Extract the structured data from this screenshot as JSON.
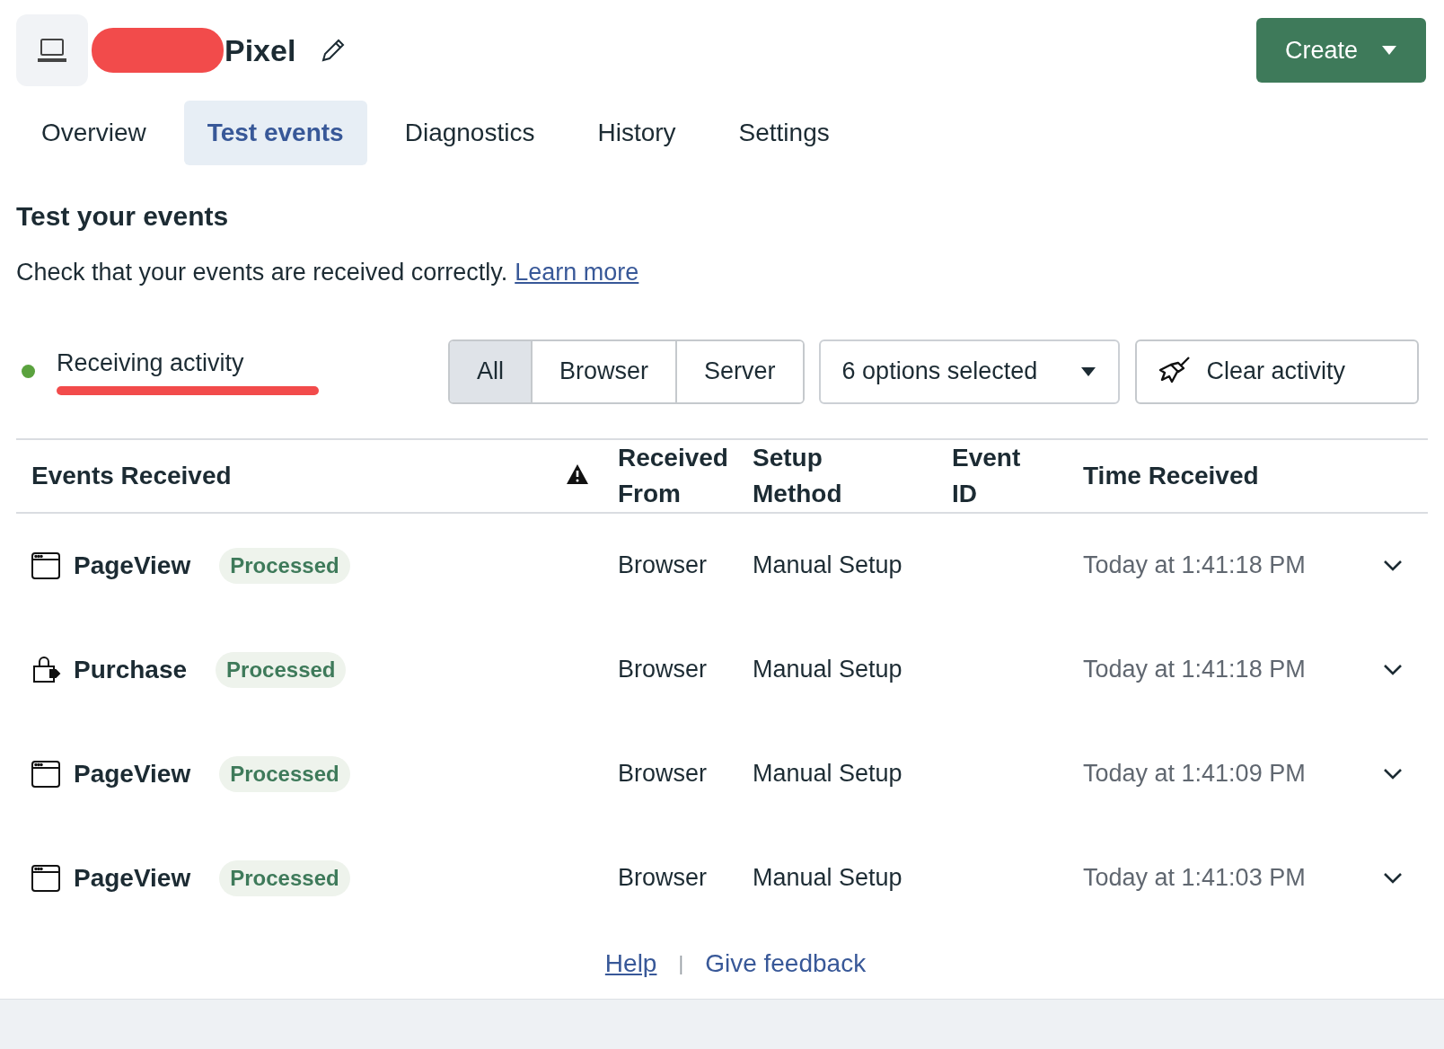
{
  "header": {
    "title": "Pixel",
    "create_button": "Create"
  },
  "tabs": [
    {
      "label": "Overview",
      "selected": false
    },
    {
      "label": "Test events",
      "selected": true
    },
    {
      "label": "Diagnostics",
      "selected": false
    },
    {
      "label": "History",
      "selected": false
    },
    {
      "label": "Settings",
      "selected": false
    }
  ],
  "section": {
    "title": "Test your events",
    "description": "Check that your events are received correctly.",
    "link": "Learn more"
  },
  "activity": {
    "status": "Receiving activity",
    "active": true
  },
  "source_filter": [
    {
      "label": "All",
      "selected": true
    },
    {
      "label": "Browser",
      "selected": false
    },
    {
      "label": "Server",
      "selected": false
    }
  ],
  "options_dropdown": "6 options selected",
  "clear_button": "Clear activity",
  "table": {
    "columns": [
      "Events Received",
      "Received From",
      "Setup Method",
      "Event ID",
      "Time Received"
    ],
    "rows": [
      {
        "kind": "pageview",
        "event": "PageView",
        "status": "Processed",
        "received_from": "Browser",
        "setup_method": "Manual Setup",
        "time": "Today at 1:41:18 PM"
      },
      {
        "kind": "purchase",
        "event": "Purchase",
        "status": "Processed",
        "received_from": "Browser",
        "setup_method": "Manual Setup",
        "time": "Today at 1:41:18 PM"
      },
      {
        "kind": "pageview",
        "event": "PageView",
        "status": "Processed",
        "received_from": "Browser",
        "setup_method": "Manual Setup",
        "time": "Today at 1:41:09 PM"
      },
      {
        "kind": "pageview",
        "event": "PageView",
        "status": "Processed",
        "received_from": "Browser",
        "setup_method": "Manual Setup",
        "time": "Today at 1:41:03 PM"
      }
    ]
  },
  "footer": {
    "links": [
      "Help",
      "Give feedback"
    ],
    "separator": "|"
  }
}
